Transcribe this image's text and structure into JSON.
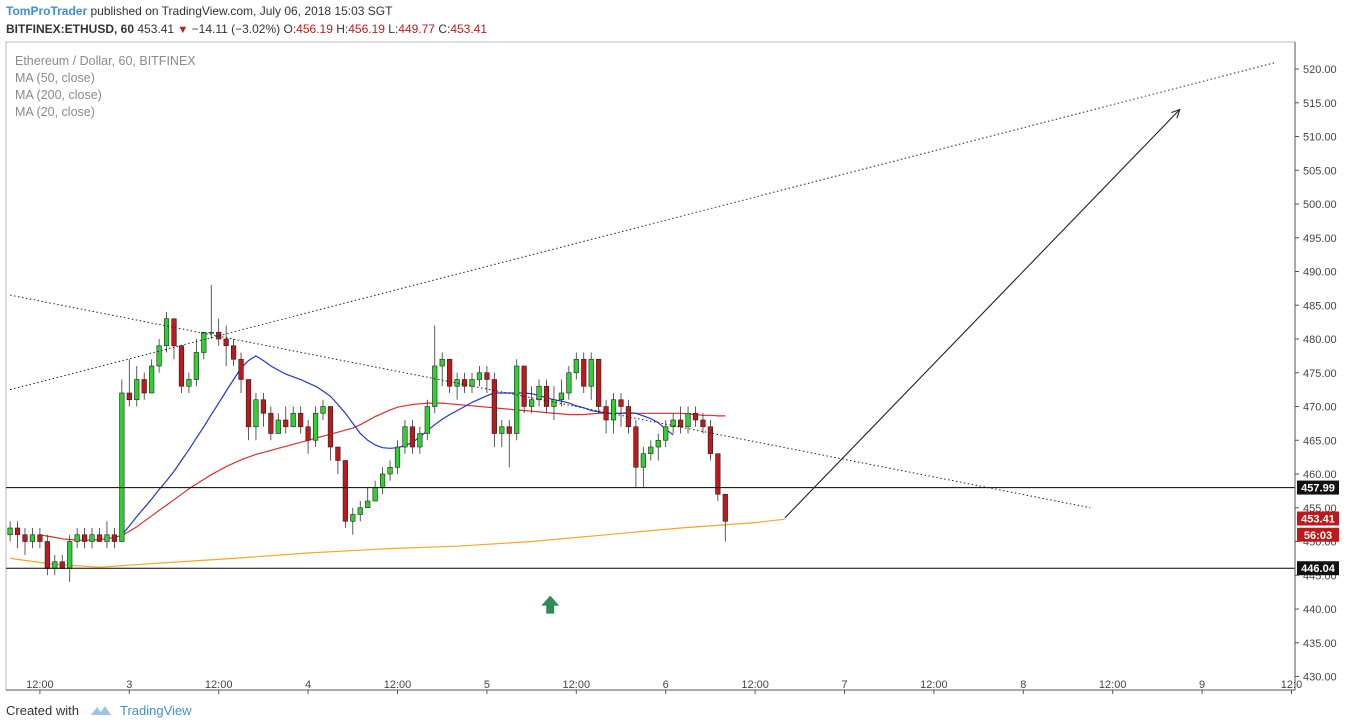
{
  "header": {
    "user": "TomProTrader",
    "published": "published on TradingView.com, July 06, 2018 15:03 SGT",
    "symbol": "BITFINEX:ETHUSD, 60",
    "last": "453.41",
    "change": "−14.11 (−3.02%)",
    "o_label": "O:",
    "o": "456.19",
    "h_label": "H:",
    "h": "456.19",
    "l_label": "L:",
    "l": "449.77",
    "c_label": "C:",
    "c": "453.41"
  },
  "legend": {
    "title": "Ethereum / Dollar, 60, BITFINEX",
    "ma50": "MA (50, close)",
    "ma200": "MA (200, close)",
    "ma20": "MA (20, close)"
  },
  "footer": {
    "created_with": "Created with",
    "brand": "TradingView"
  },
  "colors": {
    "bull": "#2fd02f",
    "bear": "#c0181b",
    "ma20": "#2233e0",
    "ma50": "#e02d2d",
    "ma200": "#f5a623",
    "arrow_marker": "#2e8b57",
    "accent": "#3d8de0"
  },
  "chart_data": {
    "type": "candlestick",
    "y_range": [
      428,
      524
    ],
    "y_ticks": [
      "430.00",
      "435.00",
      "440.00",
      "445.00",
      "450.00",
      "455.00",
      "460.00",
      "465.00",
      "470.00",
      "475.00",
      "480.00",
      "485.00",
      "490.00",
      "495.00",
      "500.00",
      "505.00",
      "510.00",
      "515.00",
      "520.00"
    ],
    "x_ticks": [
      {
        "t": 4,
        "label": "12:00"
      },
      {
        "t": 16,
        "label": "3"
      },
      {
        "t": 28,
        "label": "12:00"
      },
      {
        "t": 40,
        "label": "4"
      },
      {
        "t": 52,
        "label": "12:00"
      },
      {
        "t": 64,
        "label": "5"
      },
      {
        "t": 76,
        "label": "12:00"
      },
      {
        "t": 88,
        "label": "6"
      },
      {
        "t": 100,
        "label": "12:00"
      },
      {
        "t": 112,
        "label": "7"
      },
      {
        "t": 124,
        "label": "12:00"
      },
      {
        "t": 136,
        "label": "8"
      },
      {
        "t": 148,
        "label": "12:00"
      },
      {
        "t": 160,
        "label": "9"
      },
      {
        "t": 172,
        "label": "12:0"
      }
    ],
    "price_tags": [
      {
        "value": 457.99,
        "label": "457.99",
        "style": "black"
      },
      {
        "value": 453.41,
        "label": "453.41",
        "style": "red"
      },
      {
        "value": 451.0,
        "label": "56:03",
        "style": "red"
      },
      {
        "value": 446.04,
        "label": "446.04",
        "style": "black"
      }
    ],
    "horizontal_lines": [
      457.99,
      446.04
    ],
    "candles": [
      [
        451,
        452,
        453,
        450
      ],
      [
        452,
        451,
        453,
        449
      ],
      [
        451,
        450,
        452,
        448
      ],
      [
        450,
        451,
        452,
        449
      ],
      [
        451,
        450,
        452,
        449
      ],
      [
        450,
        446,
        451,
        445
      ],
      [
        446,
        447,
        448,
        445
      ],
      [
        447,
        446,
        448,
        446
      ],
      [
        446,
        450,
        451,
        444
      ],
      [
        450,
        451,
        452,
        449
      ],
      [
        451,
        450,
        452,
        449
      ],
      [
        450,
        451,
        452,
        449
      ],
      [
        451,
        450,
        452,
        450
      ],
      [
        450,
        451,
        453,
        449
      ],
      [
        451,
        450,
        452,
        449
      ],
      [
        450,
        472,
        474,
        450
      ],
      [
        472,
        471,
        477,
        470
      ],
      [
        471,
        474,
        476,
        470
      ],
      [
        474,
        472,
        475,
        471
      ],
      [
        472,
        476,
        477,
        472
      ],
      [
        476,
        479,
        480,
        475
      ],
      [
        479,
        483,
        484,
        478
      ],
      [
        483,
        479,
        483,
        477
      ],
      [
        479,
        473,
        479,
        472
      ],
      [
        473,
        474,
        475,
        472
      ],
      [
        474,
        478,
        480,
        473
      ],
      [
        478,
        481,
        481,
        477
      ],
      [
        481,
        481,
        488,
        480
      ],
      [
        481,
        480,
        483,
        479
      ],
      [
        480,
        479,
        482,
        476
      ],
      [
        479,
        477,
        480,
        476
      ],
      [
        477,
        474,
        478,
        472
      ],
      [
        474,
        467,
        474,
        465
      ],
      [
        467,
        471,
        472,
        465
      ],
      [
        471,
        469,
        472,
        467
      ],
      [
        469,
        466,
        470,
        465
      ],
      [
        466,
        468,
        469,
        466
      ],
      [
        468,
        467,
        470,
        466
      ],
      [
        467,
        469,
        470,
        467
      ],
      [
        469,
        467,
        470,
        466
      ],
      [
        467,
        465,
        468,
        463
      ],
      [
        465,
        469,
        470,
        464
      ],
      [
        469,
        470,
        471,
        468
      ],
      [
        470,
        464,
        470,
        462
      ],
      [
        464,
        462,
        464,
        460
      ],
      [
        462,
        453,
        462,
        452
      ],
      [
        453,
        454,
        455,
        451
      ],
      [
        454,
        455,
        456,
        453
      ],
      [
        455,
        456,
        458,
        455
      ],
      [
        456,
        458,
        459,
        456
      ],
      [
        458,
        460,
        461,
        457
      ],
      [
        460,
        461,
        462,
        459
      ],
      [
        461,
        464,
        465,
        460
      ],
      [
        464,
        467,
        468,
        463
      ],
      [
        467,
        464,
        468,
        463
      ],
      [
        464,
        466,
        467,
        463
      ],
      [
        466,
        470,
        471,
        465
      ],
      [
        470,
        476,
        482,
        469
      ],
      [
        476,
        477,
        478,
        473
      ],
      [
        477,
        473,
        477,
        472
      ],
      [
        473,
        474,
        475,
        471
      ],
      [
        474,
        473,
        475,
        472
      ],
      [
        473,
        474,
        475,
        472
      ],
      [
        474,
        475,
        476,
        473
      ],
      [
        475,
        474,
        476,
        472
      ],
      [
        474,
        466,
        475,
        464
      ],
      [
        466,
        467,
        468,
        464
      ],
      [
        467,
        466,
        468,
        461
      ],
      [
        466,
        476,
        477,
        465
      ],
      [
        476,
        470,
        476,
        469
      ],
      [
        470,
        471,
        473,
        469
      ],
      [
        471,
        473,
        474,
        470
      ],
      [
        473,
        470,
        474,
        469
      ],
      [
        470,
        471,
        473,
        468
      ],
      [
        471,
        472,
        474,
        470
      ],
      [
        472,
        475,
        476,
        471
      ],
      [
        475,
        477,
        478,
        474
      ],
      [
        477,
        473,
        478,
        472
      ],
      [
        473,
        477,
        478,
        471
      ],
      [
        477,
        470,
        477,
        469
      ],
      [
        470,
        468,
        471,
        466
      ],
      [
        468,
        471,
        472,
        466
      ],
      [
        471,
        470,
        472,
        467
      ],
      [
        470,
        467,
        471,
        466
      ],
      [
        467,
        461,
        468,
        458
      ],
      [
        461,
        463,
        464,
        458
      ],
      [
        463,
        464,
        465,
        462
      ],
      [
        464,
        465,
        466,
        462
      ],
      [
        465,
        467,
        468,
        464
      ],
      [
        467,
        468,
        469,
        466
      ],
      [
        468,
        467,
        470,
        466
      ],
      [
        467,
        469,
        470,
        466
      ],
      [
        469,
        468,
        470,
        467
      ],
      [
        468,
        467,
        469,
        466
      ],
      [
        467,
        463,
        468,
        462
      ],
      [
        463,
        457,
        463,
        456
      ],
      [
        457,
        453,
        457,
        450
      ]
    ],
    "ma20_range": {
      "start": 15,
      "values": [
        451.0,
        452.3,
        453.7,
        455.0,
        456.3,
        457.7,
        459.0,
        460.4,
        462.0,
        463.6,
        465.3,
        467.0,
        468.8,
        470.5,
        472.3,
        474.0,
        475.7,
        476.8,
        477.5,
        476.8,
        476.0,
        475.4,
        474.8,
        474.4,
        474.0,
        473.5,
        473.0,
        472.3,
        471.5,
        470.3,
        469.0,
        467.5,
        466.0,
        465.0,
        464.3,
        463.9,
        463.8,
        463.9,
        464.2,
        464.7,
        465.5,
        466.4,
        467.3,
        468.1,
        468.8,
        469.4,
        470.0,
        470.6,
        471.1,
        471.6,
        472.0,
        472.0,
        472.0,
        472.0,
        472.0,
        471.9,
        471.6,
        471.3,
        471.0,
        470.8,
        470.5,
        470.1,
        469.8,
        469.4,
        469.2,
        469.0,
        469.0,
        469.0,
        469.1,
        469.0,
        468.6,
        468.2,
        467.6,
        466.6,
        465.8
      ]
    },
    "ma50_range": {
      "start": 4,
      "values": [
        451.0,
        450.8,
        450.6,
        450.4,
        450.3,
        450.2,
        450.2,
        450.2,
        450.3,
        450.4,
        450.6,
        450.9,
        451.5,
        452.2,
        453.0,
        453.8,
        454.6,
        455.4,
        456.2,
        457.0,
        457.8,
        458.5,
        459.2,
        459.9,
        460.5,
        461.1,
        461.6,
        462.1,
        462.5,
        462.9,
        463.2,
        463.5,
        463.8,
        464.1,
        464.4,
        464.7,
        465.0,
        465.3,
        465.6,
        465.9,
        466.2,
        466.5,
        466.8,
        467.3,
        467.9,
        468.5,
        469.0,
        469.5,
        469.9,
        470.1,
        470.3,
        470.4,
        470.5,
        470.5,
        470.5,
        470.4,
        470.3,
        470.2,
        470.1,
        470.0,
        469.9,
        469.8,
        469.7,
        469.6,
        469.5,
        469.4,
        469.3,
        469.2,
        469.1,
        469.0,
        468.9,
        468.8,
        468.8,
        468.8,
        468.9,
        469.0,
        469.0,
        469.0,
        469.0,
        469.0,
        469.0,
        469.0,
        469.0,
        469.0,
        469.0,
        469.0,
        469.0,
        468.9,
        468.8,
        468.7,
        468.7,
        468.6,
        468.6
      ]
    },
    "ma200": [
      {
        "t": 0,
        "v": 447.5
      },
      {
        "t": 6,
        "v": 446.6
      },
      {
        "t": 12,
        "v": 446.2
      },
      {
        "t": 20,
        "v": 446.8
      },
      {
        "t": 30,
        "v": 447.5
      },
      {
        "t": 40,
        "v": 448.3
      },
      {
        "t": 50,
        "v": 448.9
      },
      {
        "t": 60,
        "v": 449.3
      },
      {
        "t": 70,
        "v": 450.0
      },
      {
        "t": 80,
        "v": 451.0
      },
      {
        "t": 90,
        "v": 452.0
      },
      {
        "t": 100,
        "v": 452.8
      },
      {
        "t": 104,
        "v": 453.3
      }
    ],
    "trendlines": [
      {
        "from": {
          "t": 0,
          "v": 472.5
        },
        "to": {
          "t": 170,
          "v": 521.0
        },
        "style": "dotted"
      },
      {
        "from": {
          "t": 0,
          "v": 486.5
        },
        "to": {
          "t": 145,
          "v": 455.0
        },
        "style": "dotted"
      }
    ],
    "arrow": {
      "from": {
        "t": 104,
        "v": 453.5
      },
      "to": {
        "t": 157,
        "v": 514.0
      }
    },
    "buy_marker": {
      "t": 72.5,
      "v": 440.5
    }
  }
}
